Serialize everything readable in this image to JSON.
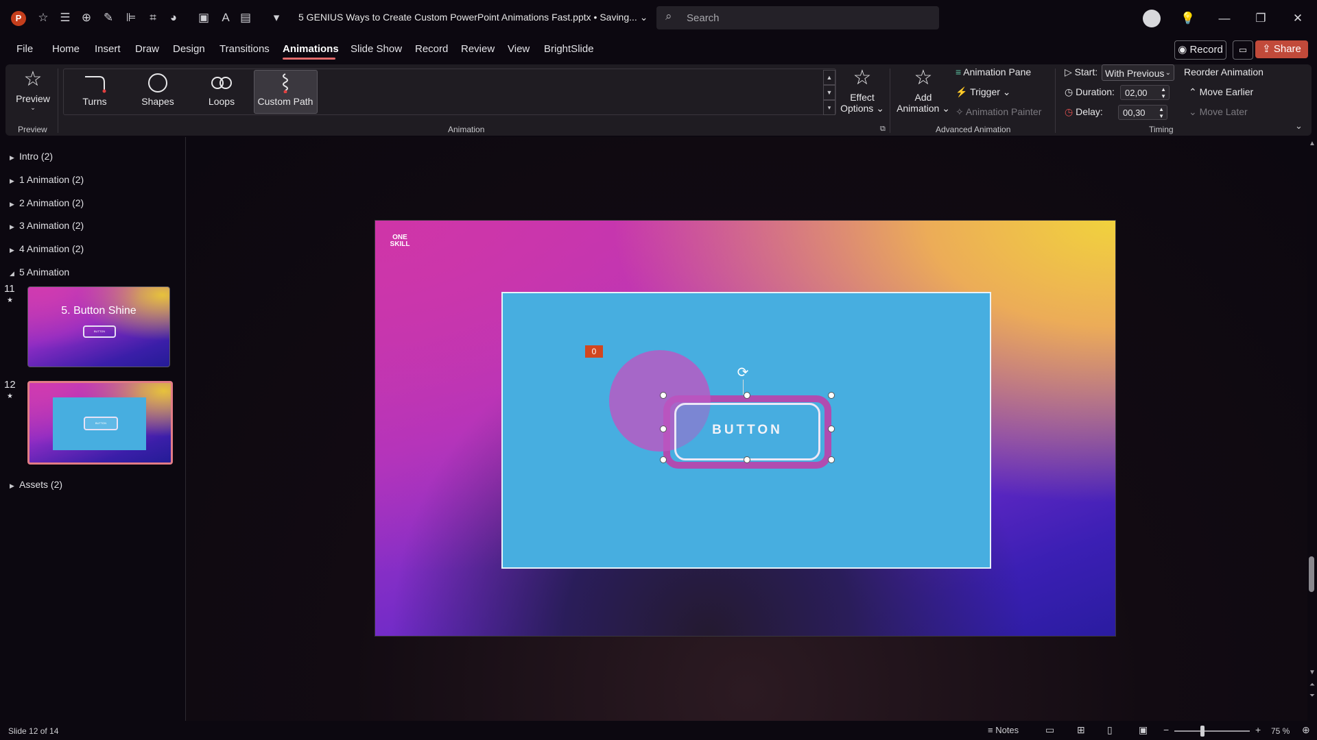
{
  "titlebar": {
    "app_logo": "P",
    "doc_title": "5 GENIUS Ways to Create Custom PowerPoint Animations Fast.pptx • Saving... ⌄",
    "search_label": "Search",
    "quick_access_icons": [
      "star-icon",
      "list-icon",
      "crosshair-icon",
      "pen-icon",
      "align-icon",
      "crop-icon",
      "shape-icon",
      "image-icon",
      "text-icon",
      "layout-icon",
      "customize-icon"
    ]
  },
  "menu": {
    "tabs": [
      "File",
      "Home",
      "Insert",
      "Draw",
      "Design",
      "Transitions",
      "Animations",
      "Slide Show",
      "Record",
      "Review",
      "View",
      "BrightSlide"
    ],
    "active_tab": "Animations",
    "record_label": "Record",
    "share_label": "Share"
  },
  "ribbon": {
    "preview_label": "Preview",
    "preview_group": "Preview",
    "gallery_items": [
      "Turns",
      "Shapes",
      "Loops",
      "Custom Path"
    ],
    "selected_item": "Custom Path",
    "animation_group": "Animation",
    "effect_options_line1": "Effect",
    "effect_options_line2": "Options ⌄",
    "add_animation_line1": "Add",
    "add_animation_line2": "Animation ⌄",
    "animation_pane": "Animation Pane",
    "trigger": "Trigger ⌄",
    "animation_painter": "Animation Painter",
    "advanced_group": "Advanced Animation",
    "start_label": "Start:",
    "start_value": "With Previous",
    "duration_label": "Duration:",
    "duration_value": "02,00",
    "delay_label": "Delay:",
    "delay_value": "00,30",
    "reorder_label": "Reorder Animation",
    "move_earlier": "Move Earlier",
    "move_later": "Move Later",
    "timing_group": "Timing",
    "accent": "#e26b6b"
  },
  "sections": {
    "intro": "Intro (2)",
    "s1": "1 Animation (2)",
    "s2": "2 Animation (2)",
    "s3": "3 Animation (2)",
    "s4": "4 Animation (2)",
    "s5": "5 Animation",
    "assets": "Assets (2)"
  },
  "slides": {
    "s11_num": "11",
    "s11_title": "5. Button Shine",
    "s11_btn": "BUTTON",
    "s12_num": "12",
    "s12_btn": "BUTTON"
  },
  "canvas": {
    "logo_line1": "ONE",
    "logo_line2": "SKILL",
    "anim_badge": "0",
    "button_text": "BUTTON",
    "blue_color": "#47aee0"
  },
  "status": {
    "slide_info": "Slide 12 of 14",
    "notes_label": "Notes",
    "zoom": "75 %"
  }
}
